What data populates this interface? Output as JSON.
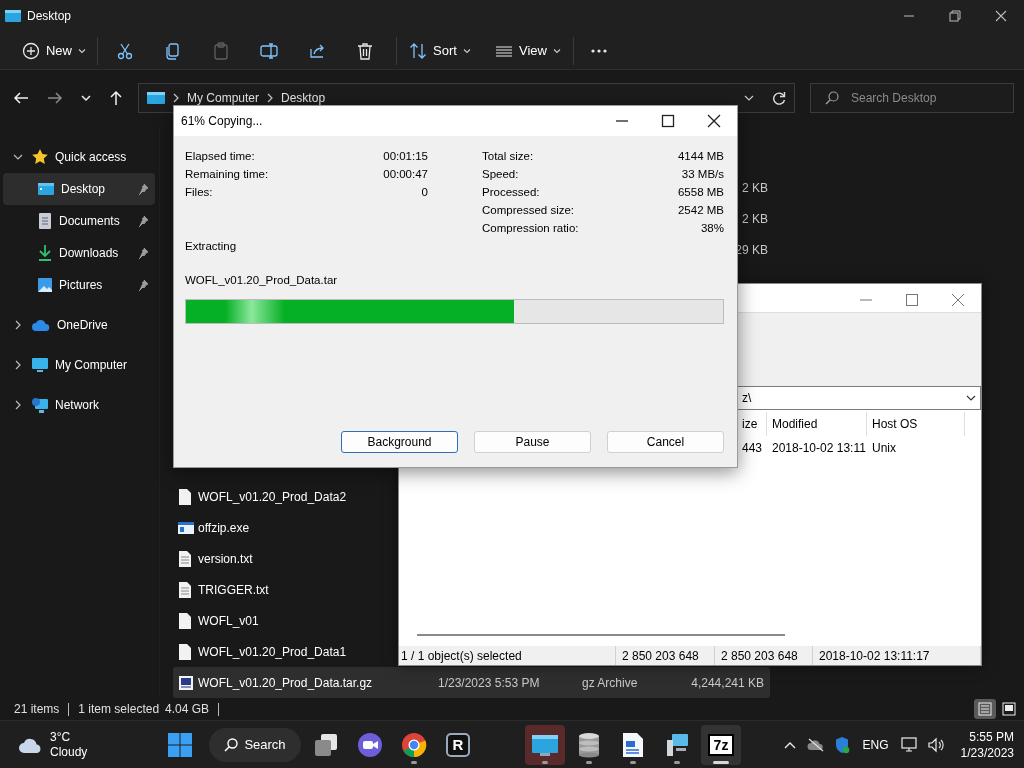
{
  "explorer": {
    "title": "Desktop",
    "toolbar": [
      {
        "kind": "new",
        "label": "New",
        "disabled": false
      },
      {
        "kind": "cut",
        "disabled": false
      },
      {
        "kind": "copy",
        "disabled": false
      },
      {
        "kind": "paste",
        "disabled": true
      },
      {
        "kind": "rename",
        "disabled": false
      },
      {
        "kind": "share",
        "disabled": false
      },
      {
        "kind": "delete",
        "disabled": false
      },
      {
        "kind": "sort",
        "label": "Sort",
        "disabled": false
      },
      {
        "kind": "view",
        "label": "View",
        "disabled": false
      },
      {
        "kind": "more",
        "disabled": false
      }
    ],
    "nav": [
      {
        "kind": "back",
        "disabled": false
      },
      {
        "kind": "forward",
        "disabled": true
      },
      {
        "kind": "recent",
        "disabled": false
      },
      {
        "kind": "up",
        "disabled": false
      }
    ],
    "address": {
      "path": [
        "My Computer",
        "Desktop"
      ]
    },
    "search": {
      "placeholder": "Search Desktop"
    },
    "sidebar": {
      "items": [
        {
          "label": "Quick access",
          "kind": "star",
          "expanded": true,
          "selected": false,
          "children": [
            {
              "label": "Desktop",
              "kind": "desktop",
              "selected": true,
              "pinned": true
            },
            {
              "label": "Documents",
              "kind": "documents",
              "selected": false,
              "pinned": true
            },
            {
              "label": "Downloads",
              "kind": "downloads",
              "selected": false,
              "pinned": true
            },
            {
              "label": "Pictures",
              "kind": "pictures",
              "selected": false,
              "pinned": true
            }
          ]
        },
        {
          "label": "OneDrive",
          "kind": "cloud",
          "expanded": false,
          "selected": false
        },
        {
          "label": "My Computer",
          "kind": "computer",
          "expanded": false,
          "selected": false
        },
        {
          "label": "Network",
          "kind": "network",
          "expanded": false,
          "selected": false
        }
      ]
    },
    "files": {
      "upper": [
        {
          "size": "2 KB",
          "selected": false
        },
        {
          "size": "2 KB",
          "selected": false
        },
        {
          "size": "29 KB",
          "selected": false
        }
      ],
      "lower": [
        {
          "name": "WOFL_v01.20_Prod_Data2",
          "kind": "file",
          "selected": false
        },
        {
          "name": "offzip.exe",
          "kind": "exe",
          "selected": false
        },
        {
          "name": "version.txt",
          "kind": "text",
          "selected": false
        },
        {
          "name": "TRIGGER.txt",
          "kind": "text",
          "selected": false
        },
        {
          "name": "WOFL_v01",
          "kind": "file",
          "selected": false
        },
        {
          "name": "WOFL_v01.20_Prod_Data1",
          "kind": "file",
          "selected": false
        },
        {
          "name": "WOFL_v01.20_Prod_Data.tar.gz",
          "kind": "archive",
          "date": "1/23/2023 5:53 PM",
          "type": "gz Archive",
          "size": "4,244,241 KB",
          "selected": true
        }
      ]
    },
    "status_bar": {
      "count": "21 items",
      "selection": "1 item selected",
      "size": "4.04 GB"
    },
    "view_modes": [
      {
        "kind": "details",
        "selected": true
      },
      {
        "kind": "tiles",
        "selected": false
      }
    ]
  },
  "archive_window": {
    "address": "z\\",
    "columns": [
      "ize",
      "Modified",
      "Host OS"
    ],
    "rows": [
      [
        "443",
        "2018-10-02 13:11",
        "Unix"
      ]
    ],
    "status_bar": [
      "1 / 1 object(s) selected",
      "2 850 203 648",
      "2 850 203 648",
      "2018-10-02 13:11:17"
    ]
  },
  "progress_dialog": {
    "title": "61% Copying...",
    "stats_left": [
      {
        "label": "Elapsed time:",
        "value": "00:01:15"
      },
      {
        "label": "Remaining time:",
        "value": "00:00:47"
      },
      {
        "label": "Files:",
        "value": "0"
      }
    ],
    "stats_right": [
      {
        "label": "Total size:",
        "value": "4144 MB"
      },
      {
        "label": "Speed:",
        "value": "33 MB/s"
      },
      {
        "label": "Processed:",
        "value": "6558 MB"
      },
      {
        "label": "Compressed size:",
        "value": "2542 MB"
      },
      {
        "label": "Compression ratio:",
        "value": "38%"
      }
    ],
    "operation": "Extracting",
    "file": "WOFL_v01.20_Prod_Data.tar",
    "level": 0.61,
    "buttons": [
      {
        "label": "Background",
        "focused": true
      },
      {
        "label": "Pause",
        "focused": false
      },
      {
        "label": "Cancel",
        "focused": false
      }
    ]
  },
  "taskbar": {
    "weather": {
      "temperature": "3°C",
      "condition": "Cloudy"
    },
    "search": {
      "label": "Search"
    },
    "app_groups": [
      [
        {
          "kind": "task-view",
          "running": false,
          "selected": false,
          "attention": false
        },
        {
          "kind": "meet",
          "running": false,
          "selected": false,
          "attention": false
        },
        {
          "kind": "chrome",
          "running": true,
          "selected": false,
          "attention": false
        },
        {
          "kind": "r-app",
          "label": "R",
          "running": false,
          "selected": false,
          "attention": false
        }
      ],
      [
        {
          "kind": "explorer",
          "running": true,
          "selected": false,
          "attention": true
        },
        {
          "kind": "database",
          "running": true,
          "selected": false,
          "attention": false
        },
        {
          "kind": "document",
          "running": true,
          "selected": false,
          "attention": false
        },
        {
          "kind": "network-setup",
          "running": true,
          "selected": false,
          "attention": false
        },
        {
          "kind": "sevenzip",
          "label": "7z",
          "running": true,
          "selected": true,
          "attention": false
        }
      ]
    ],
    "tray": {
      "language": "ENG",
      "time": "5:55 PM",
      "date": "1/23/2023"
    }
  }
}
